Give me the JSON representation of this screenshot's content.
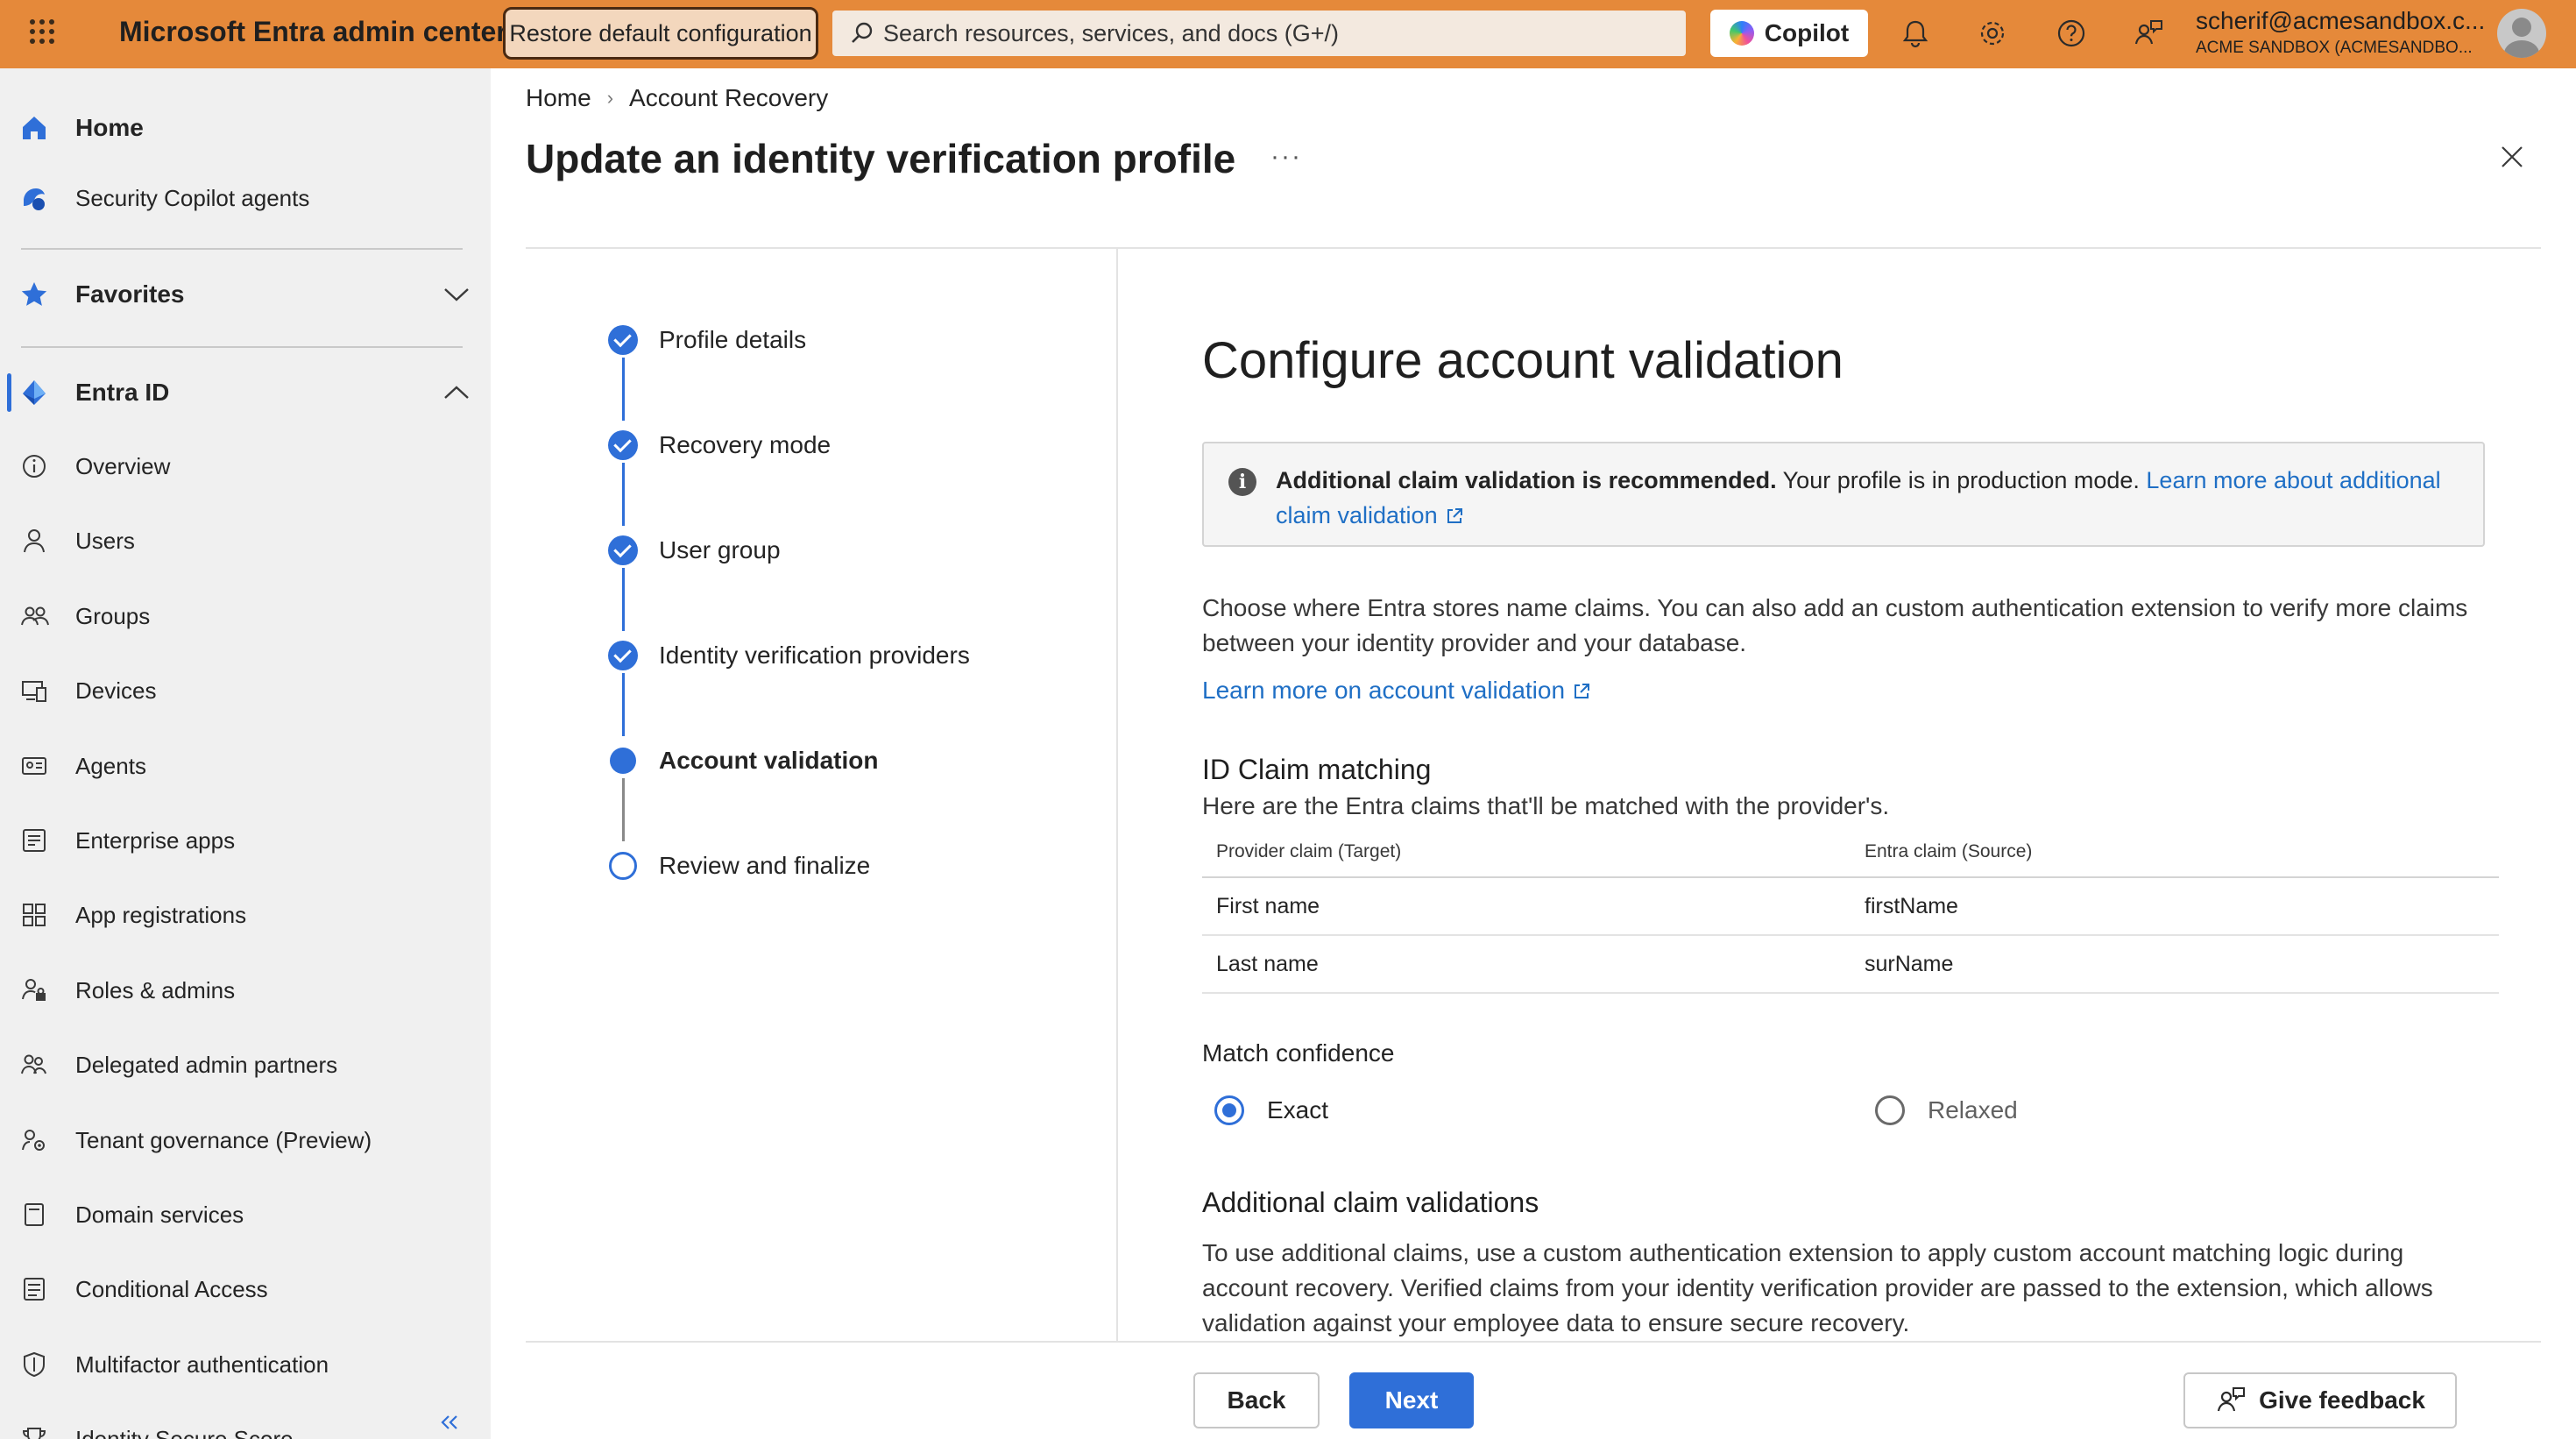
{
  "topbar": {
    "app_title": "Microsoft Entra admin center",
    "restore_label": "Restore default configuration",
    "search_placeholder": "Search resources, services, and docs (G+/)",
    "copilot_label": "Copilot",
    "icons": [
      "waffle-icon",
      "bell-icon",
      "gear-icon",
      "help-icon",
      "feedback-icon"
    ],
    "account_email": "scherif@acmesandbox.c...",
    "account_tenant": "ACME SANDBOX (ACMESANDBO..."
  },
  "sidebar": {
    "home": "Home",
    "security_copilot": "Security Copilot agents",
    "favorites": "Favorites",
    "entra_id": "Entra ID",
    "items": [
      {
        "label": "Overview",
        "icon": "info-icon"
      },
      {
        "label": "Users",
        "icon": "user-icon"
      },
      {
        "label": "Groups",
        "icon": "groups-icon"
      },
      {
        "label": "Devices",
        "icon": "devices-icon"
      },
      {
        "label": "Agents",
        "icon": "agents-icon"
      },
      {
        "label": "Enterprise apps",
        "icon": "enterprise-apps-icon"
      },
      {
        "label": "App registrations",
        "icon": "app-registrations-icon"
      },
      {
        "label": "Roles & admins",
        "icon": "roles-icon"
      },
      {
        "label": "Delegated admin partners",
        "icon": "partners-icon"
      },
      {
        "label": "Tenant governance (Preview)",
        "icon": "governance-icon"
      },
      {
        "label": "Domain services",
        "icon": "domain-icon"
      },
      {
        "label": "Conditional Access",
        "icon": "conditional-access-icon"
      },
      {
        "label": "Multifactor authentication",
        "icon": "shield-icon"
      },
      {
        "label": "Identity Secure Score",
        "icon": "trophy-icon"
      }
    ]
  },
  "breadcrumb": {
    "home": "Home",
    "current": "Account Recovery"
  },
  "page": {
    "title": "Update an identity verification profile",
    "more": "···"
  },
  "steps": [
    {
      "label": "Profile details",
      "state": "done"
    },
    {
      "label": "Recovery mode",
      "state": "done"
    },
    {
      "label": "User group",
      "state": "done"
    },
    {
      "label": "Identity verification providers",
      "state": "done"
    },
    {
      "label": "Account validation",
      "state": "current"
    },
    {
      "label": "Review and finalize",
      "state": "todo"
    }
  ],
  "content": {
    "section_title": "Configure account validation",
    "info_bold": "Additional claim validation is recommended.",
    "info_text": " Your profile is in production mode. ",
    "info_link": "Learn more about additional claim validation",
    "description": "Choose where Entra stores name claims. You can also add an custom authentication extension to verify more claims between your identity provider and your database.",
    "learn_more": "Learn more on account validation",
    "id_claim_title": "ID Claim matching",
    "id_claim_sub": "Here are the Entra claims that'll be matched with the provider's.",
    "table": {
      "headers": [
        "Provider claim (Target)",
        "Entra claim (Source)"
      ],
      "rows": [
        [
          "First name",
          "firstName"
        ],
        [
          "Last name",
          "surName"
        ]
      ]
    },
    "match_confidence": "Match confidence",
    "radio_exact": "Exact",
    "radio_relaxed": "Relaxed",
    "selected_option": "Exact",
    "additional_title": "Additional claim validations",
    "additional_text": "To use additional claims, use a custom authentication extension to apply custom account matching logic during account recovery. Verified claims from your identity verification provider are passed to the extension, which allows validation against your employee data to ensure secure recovery."
  },
  "footer": {
    "back": "Back",
    "next": "Next",
    "feedback": "Give feedback"
  },
  "colors": {
    "topbar": "#e5893a",
    "accent": "#2f6fd8",
    "link": "#1f6fc5",
    "sidebar": "#f0f0f0"
  }
}
